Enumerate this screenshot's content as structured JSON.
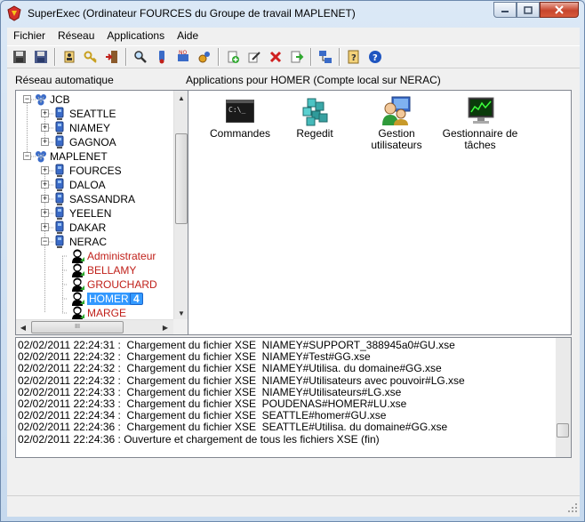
{
  "window": {
    "title": "SuperExec (Ordinateur FOURCES du Groupe de travail MAPLENET)",
    "controls": [
      "minimize",
      "maximize",
      "close"
    ]
  },
  "menu": [
    {
      "label": "Fichier"
    },
    {
      "label": "Réseau"
    },
    {
      "label": "Applications"
    },
    {
      "label": "Aide"
    }
  ],
  "toolbar": {
    "icons": [
      "save-icon",
      "save-as-icon",
      "properties-icon",
      "key-icon",
      "exit-icon",
      "find-computer-icon",
      "connect-icon",
      "disconnect-icon",
      "services-icon",
      "add-icon",
      "edit-icon",
      "delete-icon",
      "export-icon",
      "network-icon",
      "help-book-icon",
      "help-icon"
    ]
  },
  "tree_pane": {
    "title": "Réseau automatique",
    "items": [
      {
        "label": "JCB",
        "level": 0,
        "expander": "−",
        "type": "group"
      },
      {
        "label": "SEATTLE",
        "level": 1,
        "expander": "+",
        "type": "computer"
      },
      {
        "label": "NIAMEY",
        "level": 1,
        "expander": "+",
        "type": "computer"
      },
      {
        "label": "GAGNOA",
        "level": 1,
        "expander": "+",
        "type": "computer"
      },
      {
        "label": "MAPLENET",
        "level": 0,
        "expander": "−",
        "type": "group"
      },
      {
        "label": "FOURCES",
        "level": 1,
        "expander": "+",
        "type": "computer"
      },
      {
        "label": "DALOA",
        "level": 1,
        "expander": "+",
        "type": "computer"
      },
      {
        "label": "SASSANDRA",
        "level": 1,
        "expander": "+",
        "type": "computer"
      },
      {
        "label": "YEELEN",
        "level": 1,
        "expander": "+",
        "type": "computer"
      },
      {
        "label": "DAKAR",
        "level": 1,
        "expander": "+",
        "type": "computer"
      },
      {
        "label": "NERAC",
        "level": 1,
        "expander": "−",
        "type": "computer"
      },
      {
        "label": "Administrateur",
        "level": 2,
        "expander": "",
        "type": "user"
      },
      {
        "label": "BELLAMY",
        "level": 2,
        "expander": "",
        "type": "user"
      },
      {
        "label": "GROUCHARD",
        "level": 2,
        "expander": "",
        "type": "user"
      },
      {
        "label": "HOMER",
        "level": 2,
        "expander": "",
        "type": "user",
        "selected": true,
        "badge": "4"
      },
      {
        "label": "MARGE",
        "level": 2,
        "expander": "",
        "type": "user"
      }
    ]
  },
  "apps_pane": {
    "title": "Applications pour HOMER (Compte  local  sur NERAC)",
    "apps": [
      {
        "label": "Commandes",
        "icon": "command-prompt-icon"
      },
      {
        "label": "Regedit",
        "icon": "regedit-icon"
      },
      {
        "label": "Gestion utilisateurs",
        "icon": "user-management-icon"
      },
      {
        "label": "Gestionnaire de tâches",
        "icon": "task-manager-icon"
      }
    ]
  },
  "log": [
    "02/02/2011 22:24:31 :  Chargement du fichier XSE  NIAMEY#SUPPORT_388945a0#GU.xse",
    "02/02/2011 22:24:32 :  Chargement du fichier XSE  NIAMEY#Test#GG.xse",
    "02/02/2011 22:24:32 :  Chargement du fichier XSE  NIAMEY#Utilisa. du domaine#GG.xse",
    "02/02/2011 22:24:32 :  Chargement du fichier XSE  NIAMEY#Utilisateurs avec pouvoir#LG.xse",
    "02/02/2011 22:24:33 :  Chargement du fichier XSE  NIAMEY#Utilisateurs#LG.xse",
    "02/02/2011 22:24:33 :  Chargement du fichier XSE  POUDENAS#HOMER#LU.xse",
    "02/02/2011 22:24:34 :  Chargement du fichier XSE  SEATTLE#homer#GU.xse",
    "02/02/2011 22:24:36 :  Chargement du fichier XSE  SEATTLE#Utilisa. du domaine#GG.xse",
    "02/02/2011 22:24:36 : Ouverture et chargement de tous les fichiers XSE (fin)"
  ],
  "colors": {
    "user_label": "#c0201a",
    "selection": "#3399ff",
    "pane_border": "#828790"
  }
}
